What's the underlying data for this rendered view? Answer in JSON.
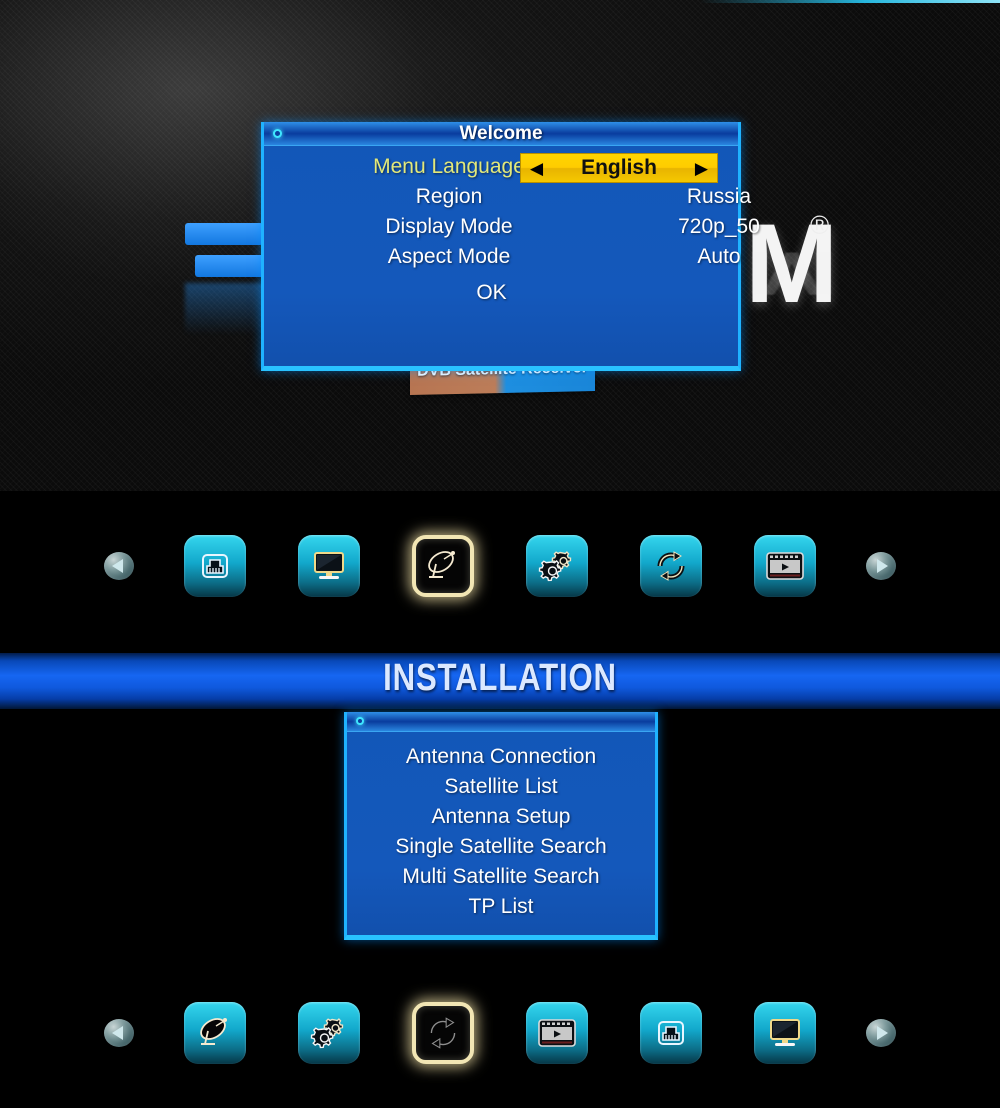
{
  "screen": {
    "brand_letter": "M",
    "brand_reg": "®",
    "product_banner": "DVB Satellite Receiver"
  },
  "welcome_dialog": {
    "title": "Welcome",
    "rows": [
      {
        "label": "Menu Language",
        "value": "English",
        "highlighted": true
      },
      {
        "label": "Region",
        "value": "Russia",
        "highlighted": false
      },
      {
        "label": "Display Mode",
        "value": "720p_50",
        "highlighted": false
      },
      {
        "label": "Aspect Mode",
        "value": "Auto",
        "highlighted": false
      }
    ],
    "prev_arrow": "◀",
    "next_arrow": "▶",
    "ok_label": "OK"
  },
  "top_iconbar": {
    "prev_label": "previous",
    "next_label": "next",
    "icons": [
      {
        "name": "network-port-icon",
        "selected": false
      },
      {
        "name": "monitor-icon",
        "selected": false
      },
      {
        "name": "satellite-dish-icon",
        "selected": true
      },
      {
        "name": "gears-icon",
        "selected": false
      },
      {
        "name": "refresh-icon",
        "selected": false
      },
      {
        "name": "media-player-icon",
        "selected": false
      }
    ]
  },
  "installation": {
    "banner_title": "INSTALLATION",
    "menu_items": [
      "Antenna Connection",
      "Satellite List",
      "Antenna Setup",
      "Single Satellite Search",
      "Multi Satellite Search",
      "TP List"
    ]
  },
  "bottom_iconbar": {
    "prev_label": "previous",
    "next_label": "next",
    "icons": [
      {
        "name": "satellite-dish-icon",
        "selected": false
      },
      {
        "name": "gears-icon",
        "selected": false
      },
      {
        "name": "refresh-icon",
        "selected": true
      },
      {
        "name": "media-player-icon",
        "selected": false
      },
      {
        "name": "network-port-icon",
        "selected": false
      },
      {
        "name": "monitor-icon",
        "selected": false
      }
    ]
  }
}
